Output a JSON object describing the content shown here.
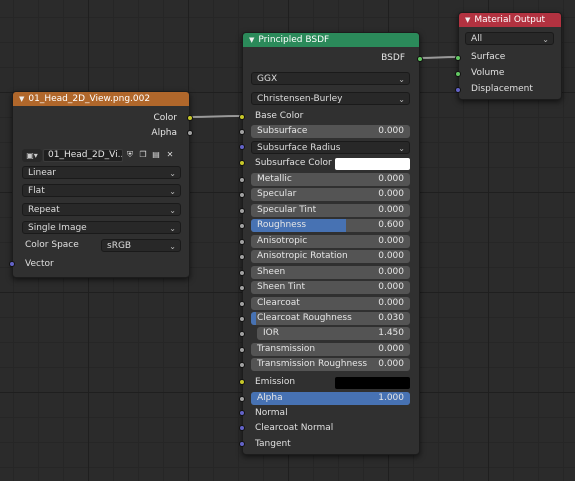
{
  "image_node": {
    "title": "01_Head_2D_View.png.002",
    "outputs": [
      "Color",
      "Alpha"
    ],
    "image_name": "01_Head_2D_Vi...",
    "interpolation": "Linear",
    "projection": "Flat",
    "extension": "Repeat",
    "source": "Single Image",
    "color_space_label": "Color Space",
    "color_space_value": "sRGB",
    "vector_label": "Vector",
    "header_color": "#b0672b"
  },
  "bsdf_node": {
    "title": "Principled BSDF",
    "output_label": "BSDF",
    "distribution": "GGX",
    "subsurface_method": "Christensen-Burley",
    "base_color_label": "Base Color",
    "subsurface_radius_label": "Subsurface Radius",
    "subsurface_color_label": "Subsurface Color",
    "subsurface_color": "#ffffff",
    "emission_label": "Emission",
    "emission_color": "#000000",
    "params": [
      {
        "label": "Subsurface",
        "value": "0.000",
        "fill": 0
      },
      {
        "label": "Metallic",
        "value": "0.000",
        "fill": 0
      },
      {
        "label": "Specular",
        "value": "0.000",
        "fill": 0
      },
      {
        "label": "Specular Tint",
        "value": "0.000",
        "fill": 0
      },
      {
        "label": "Roughness",
        "value": "0.600",
        "fill": 0.6
      },
      {
        "label": "Anisotropic",
        "value": "0.000",
        "fill": 0
      },
      {
        "label": "Anisotropic Rotation",
        "value": "0.000",
        "fill": 0
      },
      {
        "label": "Sheen",
        "value": "0.000",
        "fill": 0
      },
      {
        "label": "Sheen Tint",
        "value": "0.000",
        "fill": 0
      },
      {
        "label": "Clearcoat",
        "value": "0.000",
        "fill": 0
      },
      {
        "label": "Clearcoat Roughness",
        "value": "0.030",
        "fill": 0.03
      },
      {
        "label": "IOR",
        "value": "1.450",
        "fill": 0
      },
      {
        "label": "Transmission",
        "value": "0.000",
        "fill": 0
      },
      {
        "label": "Transmission Roughness",
        "value": "0.000",
        "fill": 0
      },
      {
        "label": "Alpha",
        "value": "1.000",
        "fill": 1
      }
    ],
    "normal_label": "Normal",
    "clearcoat_normal_label": "Clearcoat Normal",
    "tangent_label": "Tangent",
    "header_color": "#2b8a5a"
  },
  "output_node": {
    "title": "Material Output",
    "target": "All",
    "inputs": [
      "Surface",
      "Volume",
      "Displacement"
    ],
    "header_color": "#b23240"
  }
}
